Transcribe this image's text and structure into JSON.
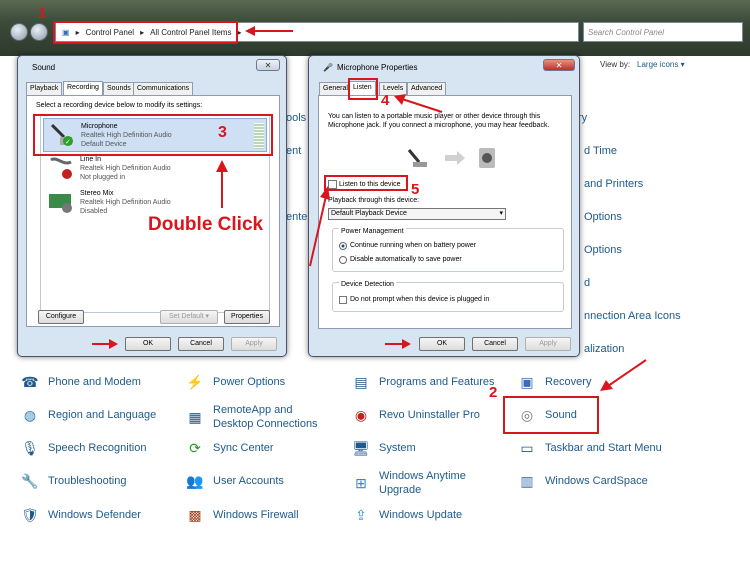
{
  "address": {
    "crumbs": [
      "Control Panel",
      "All Control Panel Items"
    ],
    "search_placeholder": "Search Control Panel"
  },
  "viewby": {
    "label": "View by:",
    "value": "Large icons ▾"
  },
  "annotations": {
    "n1": "1",
    "n2": "2",
    "n3": "3",
    "n4": "4",
    "n5": "5",
    "double_click": "Double Click"
  },
  "sound": {
    "title": "Sound",
    "tabs": [
      "Playback",
      "Recording",
      "Sounds",
      "Communications"
    ],
    "instruction": "Select a recording device below to modify its settings:",
    "devices": [
      {
        "name": "Microphone",
        "driver": "Realtek High Definition Audio",
        "status": "Default Device"
      },
      {
        "name": "Line In",
        "driver": "Realtek High Definition Audio",
        "status": "Not plugged in"
      },
      {
        "name": "Stereo Mix",
        "driver": "Realtek High Definition Audio",
        "status": "Disabled"
      }
    ],
    "configure": "Configure",
    "set_default": "Set Default",
    "properties": "Properties",
    "ok": "OK",
    "cancel": "Cancel",
    "apply": "Apply"
  },
  "mic": {
    "title": "Microphone Properties",
    "tabs": [
      "General",
      "Listen",
      "Levels",
      "Advanced"
    ],
    "desc": "You can listen to a portable music player or other device through this Microphone jack.  If you connect a microphone, you may hear feedback.",
    "listen_checkbox": "Listen to this device",
    "playback_label": "Playback through this device:",
    "playback_value": "Default Playback Device",
    "power_group": "Power Management",
    "power_opt1": "Continue running when on battery power",
    "power_opt2": "Disable automatically to save power",
    "detect_group": "Device Detection",
    "detect_checkbox": "Do not prompt when this device is plugged in",
    "ok": "OK",
    "cancel": "Cancel",
    "apply": "Apply"
  },
  "side_fragments": [
    "ools",
    "ent",
    "ente",
    "d Time",
    "and Printers",
    "Options",
    "Options",
    "d",
    "nnection Area Icons",
    "alization",
    "ry"
  ],
  "items": [
    [
      "Phone and Modem",
      "Power Options",
      "Programs and Features",
      "Recovery"
    ],
    [
      "Region and Language",
      "RemoteApp and Desktop Connections",
      "Revo Uninstaller Pro",
      "Sound"
    ],
    [
      "Speech Recognition",
      "Sync Center",
      "System",
      "Taskbar and Start Menu"
    ],
    [
      "Troubleshooting",
      "User Accounts",
      "Windows Anytime Upgrade",
      "Windows CardSpace"
    ],
    [
      "Windows Defender",
      "Windows Firewall",
      "Windows Update",
      ""
    ]
  ],
  "colors": {
    "annotation_red": "#d8161d",
    "link_blue": "#1f5a8c"
  }
}
